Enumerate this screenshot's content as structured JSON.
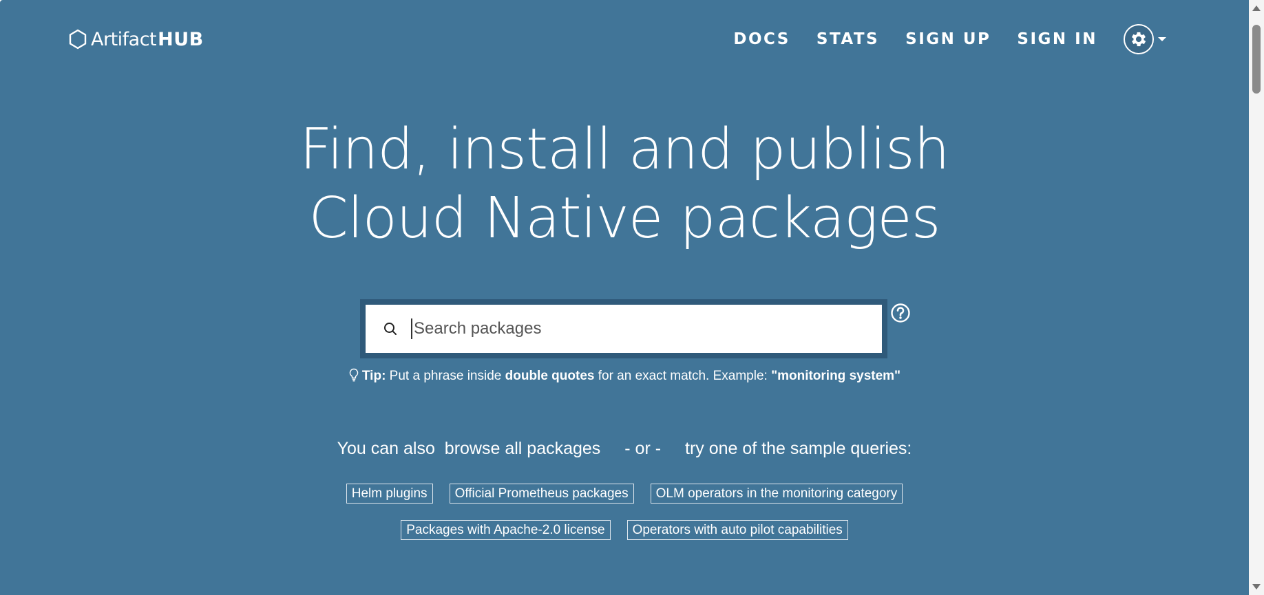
{
  "brand": {
    "name_part1": "Artifact",
    "name_part2": "HUB",
    "logo_icon": "hexagon-icon"
  },
  "nav": {
    "items": [
      {
        "label": "DOCS"
      },
      {
        "label": "STATS"
      },
      {
        "label": "SIGN UP"
      },
      {
        "label": "SIGN IN"
      }
    ],
    "settings_icon": "gear-icon"
  },
  "hero": {
    "title_line1": "Find, install and publish",
    "title_line2": "Cloud Native packages"
  },
  "search": {
    "placeholder": "Search packages",
    "value": "",
    "help_icon": "question-circle-icon"
  },
  "tip": {
    "label": "Tip:",
    "text1": " Put a phrase inside ",
    "emphasis": "double quotes",
    "text2": " for an exact match. Example: ",
    "example": "\"monitoring system\""
  },
  "browse": {
    "prefix": "You can also",
    "browse_link": "browse all packages",
    "separator": "- or -",
    "suffix": "try one of the sample queries:"
  },
  "sample_queries": {
    "row1": [
      "Helm plugins",
      "Official Prometheus packages",
      "OLM operators in the monitoring category"
    ],
    "row2": [
      "Packages with Apache-2.0 license",
      "Operators with auto pilot capabilities"
    ]
  },
  "colors": {
    "hero_background": "#417598",
    "search_frame": "#2f5a7a",
    "text": "#ffffff"
  }
}
